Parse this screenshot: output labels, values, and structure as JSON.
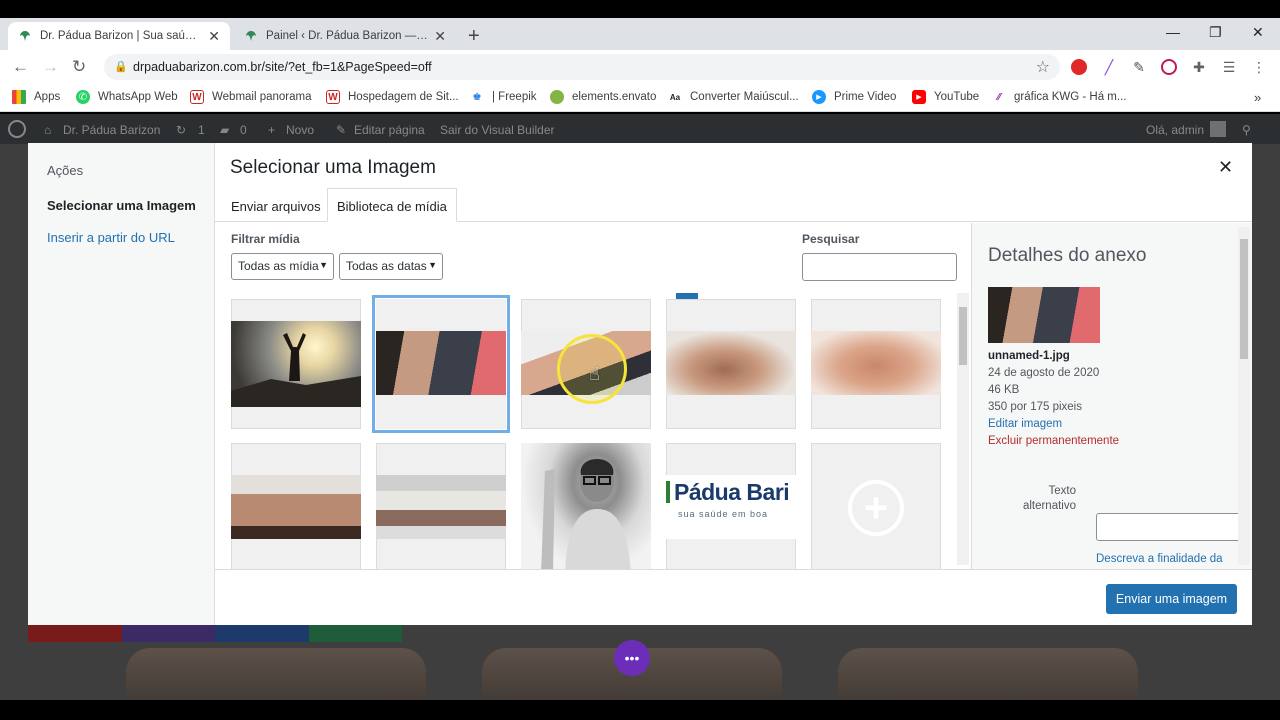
{
  "browser": {
    "tabs": [
      {
        "title": "Dr. Pádua Barizon | Sua saúde em",
        "active": true
      },
      {
        "title": "Painel ‹ Dr. Pádua Barizon — Wo",
        "active": false
      }
    ],
    "url": "drpaduabarizon.com.br/site/?et_fb=1&PageSpeed=off",
    "bookmarks": [
      {
        "label": "Apps",
        "icon": "apps-grid-icon"
      },
      {
        "label": "WhatsApp Web",
        "icon": "whatsapp-icon"
      },
      {
        "label": "Webmail panorama",
        "icon": "webmail-icon"
      },
      {
        "label": "Hospedagem de Sit...",
        "icon": "hosting-icon"
      },
      {
        "label": "| Freepik",
        "icon": "freepik-icon"
      },
      {
        "label": "elements.envato",
        "icon": "envato-icon"
      },
      {
        "label": "Converter Maiúscul...",
        "icon": "converter-icon"
      },
      {
        "label": "Prime Video",
        "icon": "prime-video-icon"
      },
      {
        "label": "YouTube",
        "icon": "youtube-icon"
      },
      {
        "label": "gráfica KWG - Há m...",
        "icon": "kwg-icon"
      }
    ]
  },
  "adminbar": {
    "site_name": "Dr. Pádua Barizon",
    "updates_count": "1",
    "comments_count": "0",
    "new_label": "Novo",
    "edit_label": "Editar página",
    "exit_label": "Sair do Visual Builder",
    "greeting": "Olá, admin"
  },
  "modal": {
    "menu_title": "Ações",
    "menu_items": [
      "Selecionar uma Imagem",
      "Inserir a partir do URL"
    ],
    "title": "Selecionar uma Imagem",
    "tabs": [
      "Enviar arquivos",
      "Biblioteca de mídia"
    ],
    "filter_label": "Filtrar mídia",
    "filter_type": "Todas as mídia",
    "filter_date": "Todas as datas",
    "search_label": "Pesquisar",
    "search_value": "",
    "attachments": [
      {
        "name": "mountain-sunrise",
        "selected": false
      },
      {
        "name": "unnamed-1",
        "selected": true
      },
      {
        "name": "massage-arm",
        "selected": false
      },
      {
        "name": "back-massage",
        "selected": false
      },
      {
        "name": "shoulder-massage",
        "selected": false
      },
      {
        "name": "cupping-therapy",
        "selected": false
      },
      {
        "name": "physiotherapy",
        "selected": false
      },
      {
        "name": "doctor-portrait",
        "selected": false
      },
      {
        "name": "padua-logo",
        "selected": false
      },
      {
        "name": "add-placeholder",
        "selected": false
      }
    ],
    "logo_text": "Pádua Bari",
    "logo_tagline": "sua saúde em boa",
    "details": {
      "heading": "Detalhes do anexo",
      "filename": "unnamed-1.jpg",
      "date": "24 de agosto de 2020",
      "size": "46 KB",
      "dimensions": "350 por 175 pixeis",
      "edit_link": "Editar imagem",
      "delete_link": "Excluir permanentemente",
      "alt_label_1": "Texto",
      "alt_label_2": "alternativo",
      "alt_value": "",
      "alt_help": "Descreva a finalidade da"
    },
    "submit_label": "Enviar uma imagem"
  },
  "colors": {
    "primary": "#2271b1",
    "danger": "#b32d2e",
    "selection_ring": "#72aee6"
  }
}
